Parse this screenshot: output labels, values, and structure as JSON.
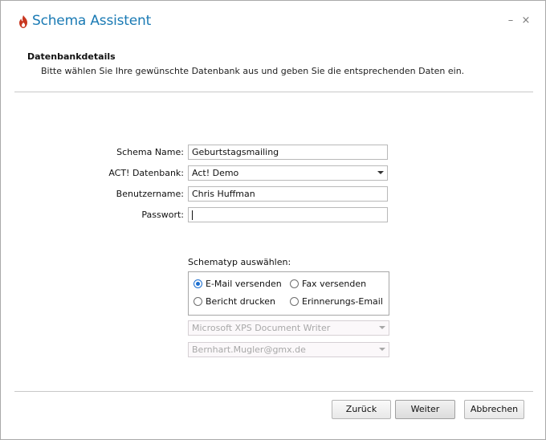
{
  "window": {
    "title": "Schema Assistent",
    "minimize_glyph": "–",
    "close_glyph": "×"
  },
  "section": {
    "title": "Datenbankdetails",
    "description": "Bitte wählen Sie Ihre gewünschte Datenbank aus und geben Sie die entsprechenden Daten ein."
  },
  "form": {
    "schema_name_label": "Schema Name:",
    "schema_name_value": "Geburtstagsmailing",
    "database_label": "ACT! Datenbank:",
    "database_value": "Act! Demo",
    "username_label": "Benutzername:",
    "username_value": "Chris Huffman",
    "password_label": "Passwort:",
    "password_value": ""
  },
  "schematype": {
    "label": "Schematyp auswählen:",
    "options": [
      {
        "label": "E-Mail versenden",
        "selected": true
      },
      {
        "label": "Fax versenden",
        "selected": false
      },
      {
        "label": "Bericht drucken",
        "selected": false
      },
      {
        "label": "Erinnerungs-Email",
        "selected": false
      }
    ],
    "printer_value": "Microsoft XPS Document Writer",
    "email_value": "Bernhart.Mugler@gmx.de"
  },
  "buttons": {
    "back": "Zurück",
    "next": "Weiter",
    "cancel": "Abbrechen"
  },
  "colors": {
    "title": "#1a7ab4",
    "icon": "#c8361f",
    "radio_selected": "#1c6fd0"
  },
  "icons": {
    "app": "flame-logo-icon"
  }
}
